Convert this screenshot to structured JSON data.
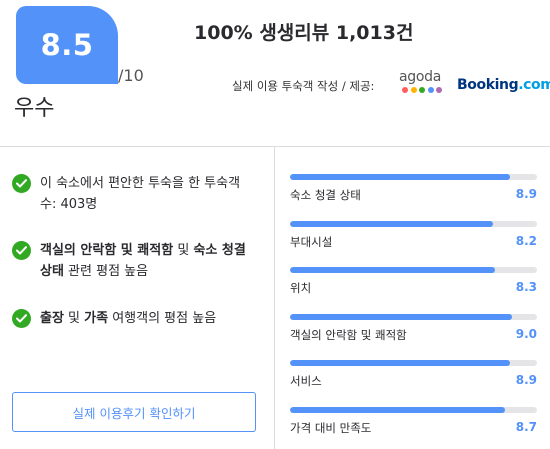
{
  "score": {
    "value": "8.5",
    "max": "/10",
    "grade": "우수"
  },
  "headline": "100% 생생리뷰 1,013건",
  "sources": {
    "label": "실제 이용 투숙객 작성 / 제공:",
    "agoda": {
      "text": "agoda",
      "dot_colors": [
        "#ff5d5d",
        "#ffb400",
        "#32a923",
        "#5392f9",
        "#b06ab3"
      ]
    },
    "booking": {
      "name": "Booking",
      "suffix": ".com"
    }
  },
  "highlights": [
    {
      "segments": [
        {
          "text": "이 숙소에서 편안한 투숙을 한 투숙객 수: 403명",
          "bold": false
        }
      ]
    },
    {
      "segments": [
        {
          "text": "객실의 안락함 및 쾌적함",
          "bold": true
        },
        {
          "text": " 및 ",
          "bold": false
        },
        {
          "text": "숙소 청결 상태",
          "bold": true
        },
        {
          "text": " 관련 평점 높음",
          "bold": false
        }
      ]
    },
    {
      "segments": [
        {
          "text": "출장",
          "bold": true
        },
        {
          "text": " 및 ",
          "bold": false
        },
        {
          "text": "가족",
          "bold": true
        },
        {
          "text": " 여행객의 평점 높음",
          "bold": false
        }
      ]
    }
  ],
  "reviews_button": "실제 이용후기 확인하기",
  "ratings": [
    {
      "label": "숙소 청결 상태",
      "value": "8.9",
      "fraction": 0.89
    },
    {
      "label": "부대시설",
      "value": "8.2",
      "fraction": 0.82
    },
    {
      "label": "위치",
      "value": "8.3",
      "fraction": 0.83
    },
    {
      "label": "객실의 안락함 및 쾌적함",
      "value": "9.0",
      "fraction": 0.9
    },
    {
      "label": "서비스",
      "value": "8.9",
      "fraction": 0.89
    },
    {
      "label": "가격 대비 만족도",
      "value": "8.7",
      "fraction": 0.87
    }
  ]
}
